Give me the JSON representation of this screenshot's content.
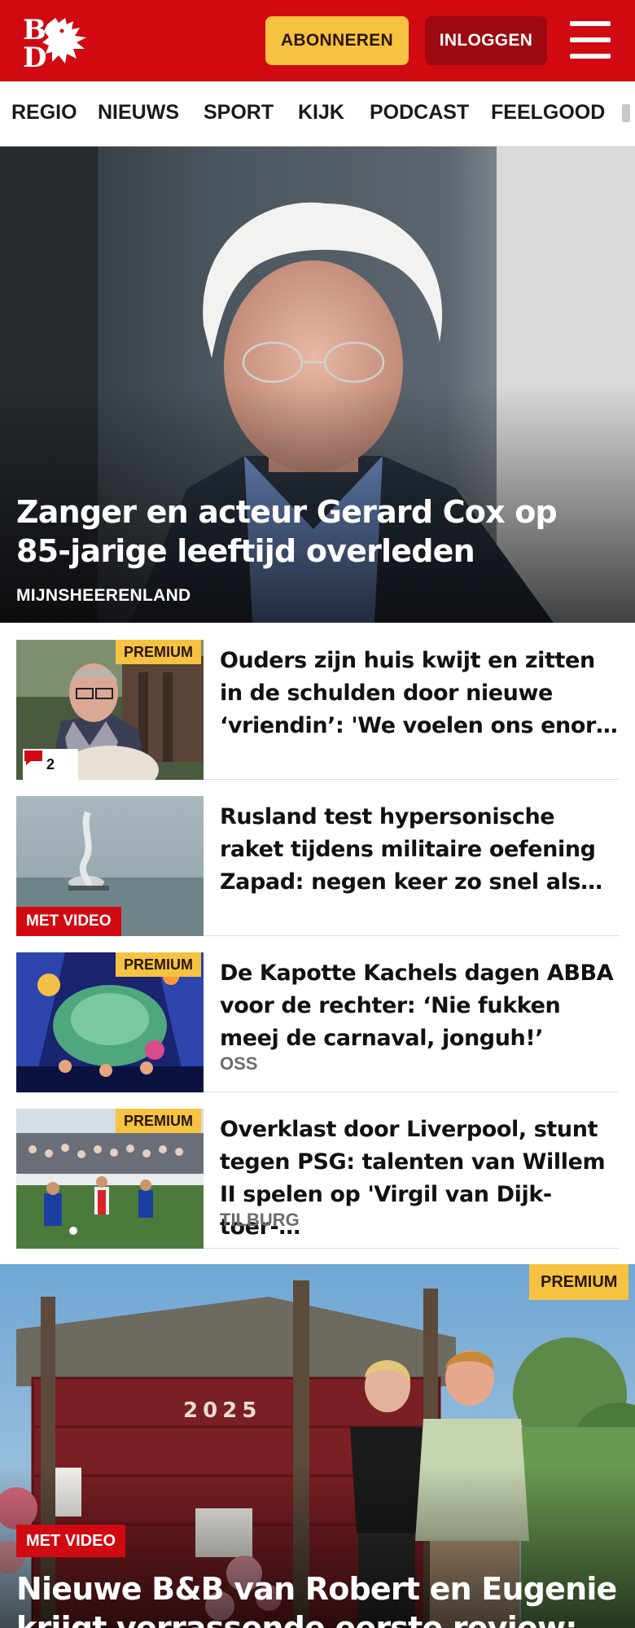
{
  "header": {
    "logo_text": "BD",
    "subscribe_label": "ABONNEREN",
    "login_label": "INLOGGEN",
    "colors": {
      "brand": "#d10a11",
      "subscribe": "#f5c341",
      "login": "#9e0910"
    }
  },
  "nav": {
    "items": [
      "REGIO",
      "NIEUWS",
      "SPORT",
      "KIJK",
      "PODCAST",
      "FEELGOOD"
    ]
  },
  "hero": {
    "title": "Zanger en acteur Gerard Cox op 85-jarige leeftijd overleden",
    "location": "MIJNSHEERENLAND"
  },
  "articles": [
    {
      "title": "Ouders zijn huis kwijt en zitten in de schulden door nieuwe ‘vriendin’: 'We voelen ons enor…",
      "badge": "PREMIUM",
      "comments": "2",
      "location": ""
    },
    {
      "title": "Rusland test hypersonische raket tijdens militaire oefening Zapad: negen keer zo snel als…",
      "badge": "MET VIDEO",
      "location": ""
    },
    {
      "title": "De Kapotte Kachels dagen ABBA voor de rechter: ‘Nie fukken meej de carnaval, jonguh!’",
      "badge": "PREMIUM",
      "location": "OSS"
    },
    {
      "title": "Overklast door Liverpool, stunt tegen PSG: talenten van Willem II spelen op 'Virgil van Dijk-toer-…",
      "badge": "PREMIUM",
      "location": "TILBURG"
    }
  ],
  "feature": {
    "badge_premium": "PREMIUM",
    "badge_video": "MET VIDEO",
    "title": "Nieuwe B&B van Robert en Eugenie krijgt verrassende eerste review:",
    "house_number": "2025"
  }
}
